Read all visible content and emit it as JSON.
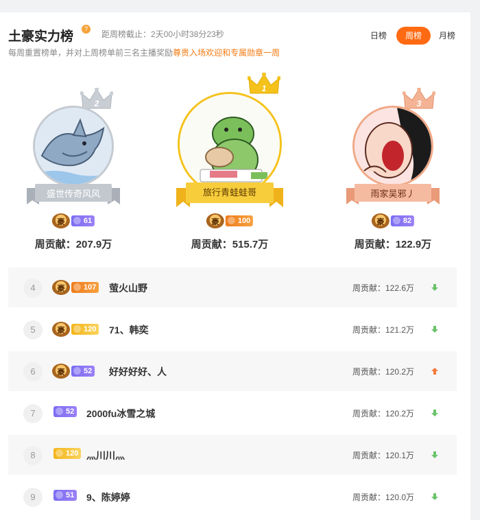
{
  "header": {
    "title": "土豪实力榜",
    "help_icon": "?",
    "countdown": "距周榜截止：2天00小时38分23秒",
    "desc_prefix": "每周重置榜单，并对上周榜单前三名主播奖励",
    "desc_highlight": "尊贵入场欢迎和专属勋章一周"
  },
  "tabs": [
    {
      "label": "日榜",
      "active": false
    },
    {
      "label": "周榜",
      "active": true
    },
    {
      "label": "月榜",
      "active": false
    }
  ],
  "colors": {
    "accent": "#ff6a12",
    "gold": "#f5c21b",
    "silver": "#b9bec6",
    "bronze": "#f0a987",
    "up": "#f47a3b",
    "down": "#6bc36b"
  },
  "podium": [
    {
      "place": "2",
      "name": "盛世传奇风风",
      "level": "61",
      "level_style": "purple",
      "contribution": "周贡献：207.9万"
    },
    {
      "place": "1",
      "name": "旅行青蛙蛙哥",
      "level": "100",
      "level_style": "orange",
      "contribution": "周贡献：515.7万"
    },
    {
      "place": "3",
      "name": "雨家吴邪丿",
      "level": "82",
      "level_style": "purple",
      "contribution": "周贡献：122.9万"
    }
  ],
  "list": [
    {
      "rank": "4",
      "name": "萤火山野",
      "level": "107",
      "level_style": "orange",
      "has_hao": true,
      "contribution": "周贡献：122.6万",
      "trend": "down"
    },
    {
      "rank": "5",
      "name": "71、韩奕",
      "level": "120",
      "level_style": "gold",
      "has_hao": true,
      "contribution": "周贡献：121.2万",
      "trend": "down"
    },
    {
      "rank": "6",
      "name": "好好好好、人",
      "level": "52",
      "level_style": "purple",
      "has_hao": true,
      "contribution": "周贡献：120.2万",
      "trend": "up"
    },
    {
      "rank": "7",
      "name": "2000fu冰雪之城",
      "level": "52",
      "level_style": "purple",
      "has_hao": false,
      "contribution": "周贡献：120.2万",
      "trend": "down"
    },
    {
      "rank": "8",
      "name": "灬川川灬",
      "level": "120",
      "level_style": "gold",
      "has_hao": false,
      "contribution": "周贡献：120.1万",
      "trend": "down"
    },
    {
      "rank": "9",
      "name": "9、陈婷婷",
      "level": "51",
      "level_style": "purple",
      "has_hao": false,
      "contribution": "周贡献：120.0万",
      "trend": "down"
    }
  ]
}
